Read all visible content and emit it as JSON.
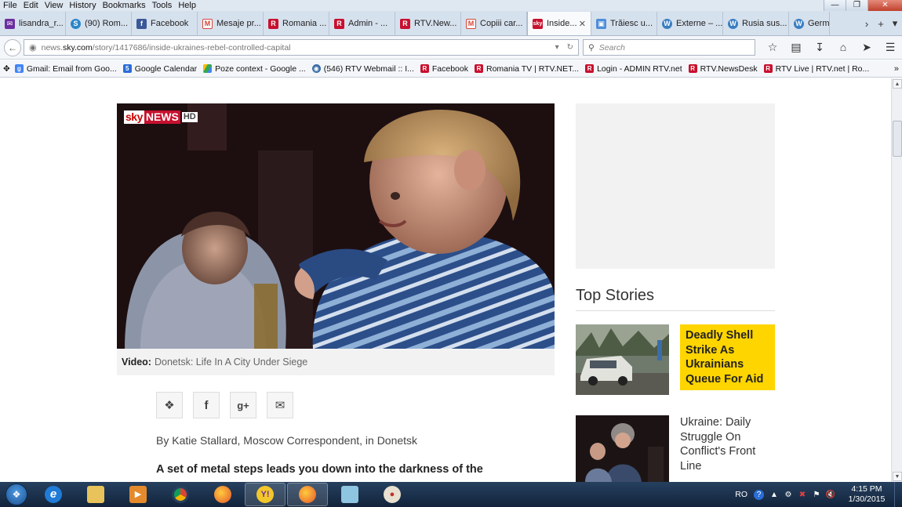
{
  "menu": [
    "File",
    "Edit",
    "View",
    "History",
    "Bookmarks",
    "Tools",
    "Help"
  ],
  "tabs": [
    {
      "label": "lisandra_r...",
      "icon": "mail-icon",
      "color": "#6b2fa0"
    },
    {
      "label": "(90) Rom...",
      "icon": "skype-icon",
      "color": "#2a86c9"
    },
    {
      "label": "Facebook",
      "icon": "facebook-icon",
      "color": "#3b5998"
    },
    {
      "label": "Mesaje pr...",
      "icon": "gmail-icon",
      "color": "#d44638"
    },
    {
      "label": "Romania ...",
      "icon": "rtv-icon",
      "color": "#c8102e"
    },
    {
      "label": "Admin - ...",
      "icon": "rtv-icon",
      "color": "#c8102e"
    },
    {
      "label": "RTV.New...",
      "icon": "rtv-icon",
      "color": "#c8102e"
    },
    {
      "label": "Copiii car...",
      "icon": "gmail-icon",
      "color": "#d44638"
    },
    {
      "label": "Inside...",
      "icon": "sky-icon",
      "color": "#c8102e",
      "active": true
    },
    {
      "label": "Trăiesc u...",
      "icon": "page-icon",
      "color": "#4d8ed8"
    },
    {
      "label": "Externe – ...",
      "icon": "wordpress-icon",
      "color": "#3a7ec2"
    },
    {
      "label": "Rusia sus...",
      "icon": "wordpress-icon",
      "color": "#3a7ec2"
    },
    {
      "label": "Germ",
      "icon": "wordpress-icon",
      "color": "#3a7ec2"
    }
  ],
  "nav": {
    "url_prefix": "news.",
    "url_domain": "sky.com",
    "url_path": "/story/1417686/inside-ukraines-rebel-controlled-capital",
    "search_placeholder": "Search"
  },
  "bookmarks": [
    {
      "label": "Gmail: Email from Goo...",
      "icon": "google-icon",
      "color": "#4285f4"
    },
    {
      "label": "Google Calendar",
      "icon": "calendar-icon",
      "color": "#2a6dd8"
    },
    {
      "label": "Poze context - Google ...",
      "icon": "drive-icon",
      "color": "#34a853"
    },
    {
      "label": "(546) RTV Webmail :: I...",
      "icon": "webmail-icon",
      "color": "#3a6ea8"
    },
    {
      "label": "Facebook",
      "icon": "rtv-icon",
      "color": "#c8102e"
    },
    {
      "label": "Romania TV | RTV.NET...",
      "icon": "rtv-icon",
      "color": "#c8102e"
    },
    {
      "label": "Login - ADMIN RTV.net",
      "icon": "rtv-icon",
      "color": "#c8102e"
    },
    {
      "label": "RTV.NewsDesk",
      "icon": "rtv-icon",
      "color": "#c8102e"
    },
    {
      "label": "RTV Live | RTV.net | Ro...",
      "icon": "rtv-icon",
      "color": "#c8102e"
    }
  ],
  "article": {
    "logo": {
      "sky": "sky",
      "news": "NEWS",
      "hd": "HD"
    },
    "caption_label": "Video:",
    "caption_text": "Donetsk: Life In A City Under Siege",
    "byline": "By Katie Stallard, Moscow Correspondent, in Donetsk",
    "lead": "A set of metal steps leads you down into the darkness of the"
  },
  "sidebar": {
    "title": "Top Stories",
    "stories": [
      {
        "headline": "Deadly Shell Strike As Ukrainians Queue For Aid",
        "featured": true
      },
      {
        "headline": "Ukraine: Daily Struggle On Conflict's Front Line",
        "featured": false
      }
    ]
  },
  "taskbar": {
    "lang": "RO",
    "time": "4:15 PM",
    "date": "1/30/2015"
  },
  "colors": {
    "sky_red": "#c8102e",
    "featured_yellow": "#ffd500"
  }
}
